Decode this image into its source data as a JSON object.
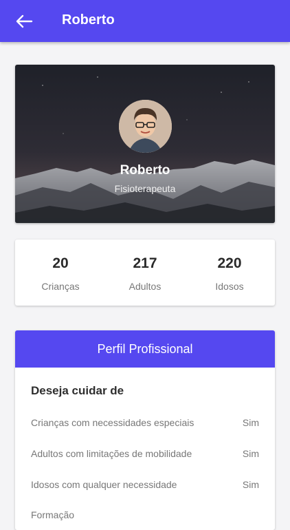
{
  "appbar": {
    "title": "Roberto",
    "bg_color": "#5548f0",
    "back_icon": "arrow-left-icon"
  },
  "hero": {
    "name": "Roberto",
    "role": "Fisioterapeuta",
    "background": "night mountain landscape",
    "avatar": "profile-photo"
  },
  "stats": [
    {
      "value": "20",
      "label": "Crianças"
    },
    {
      "value": "217",
      "label": "Adultos"
    },
    {
      "value": "220",
      "label": "Idosos"
    }
  ],
  "profile": {
    "header": "Perfil Profissional",
    "section_title": "Deseja cuidar de",
    "items": [
      {
        "label": "Crianças com necessidades especiais",
        "value": "Sim"
      },
      {
        "label": "Adultos com limitações de mobilidade",
        "value": "Sim"
      },
      {
        "label": "Idosos com qualquer necessidade",
        "value": "Sim"
      }
    ],
    "next_section": "Formação"
  }
}
